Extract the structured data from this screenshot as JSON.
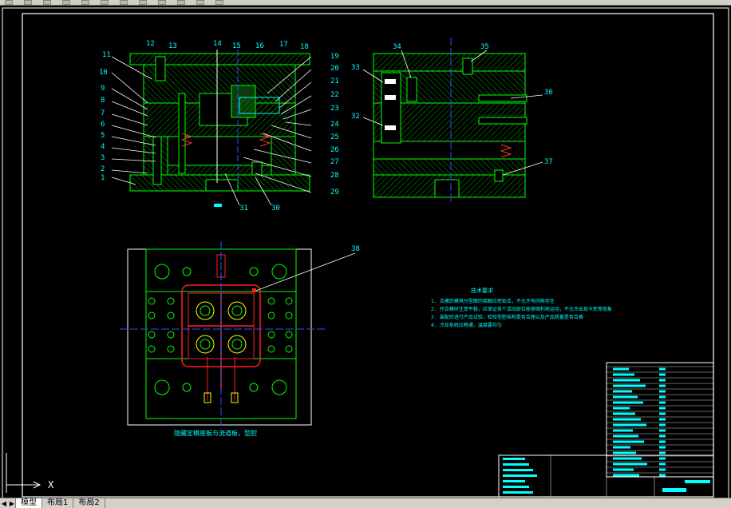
{
  "tabs": [
    {
      "label": "模型",
      "active": true
    },
    {
      "label": "布局1",
      "active": false
    },
    {
      "label": "布局2",
      "active": false
    }
  ],
  "part_numbers": {
    "left_view": [
      "11",
      "12",
      "13",
      "14",
      "15",
      "16",
      "17",
      "18",
      "19",
      "20",
      "10",
      "9",
      "8",
      "7",
      "6",
      "5",
      "4",
      "3",
      "2",
      "1",
      "21",
      "22",
      "23",
      "24",
      "25",
      "26",
      "27",
      "28",
      "29",
      "30",
      "31"
    ],
    "right_view": [
      "34",
      "35",
      "33",
      "36",
      "32",
      "37"
    ],
    "plan_view": [
      "38"
    ]
  },
  "tech_notes": {
    "title": "技术要求",
    "items": [
      "1. 合模后模具分型面的接触应密贴合，不允许有间隙存在",
      "2. 开合模时注意平稳，应保证各个活动部位能够顺利地运动，不允许出现卡死等现象",
      "3. 装配后进行产品试验，检验型腔结构是否合理以及产品质量是否合格",
      "4. 冷却系统应畅通，温度要均匀"
    ]
  },
  "plan_caption": "隐藏定模座板与流道板，型腔",
  "axis_label": "X",
  "colors": {
    "background": "#000000",
    "frame": "#ffffff",
    "geometry": "#00ff00",
    "text": "#00ffff",
    "hatch": "#00a000",
    "centerline": "#3050ff",
    "runner": "#ff2020",
    "cavity": "#ffff00"
  }
}
